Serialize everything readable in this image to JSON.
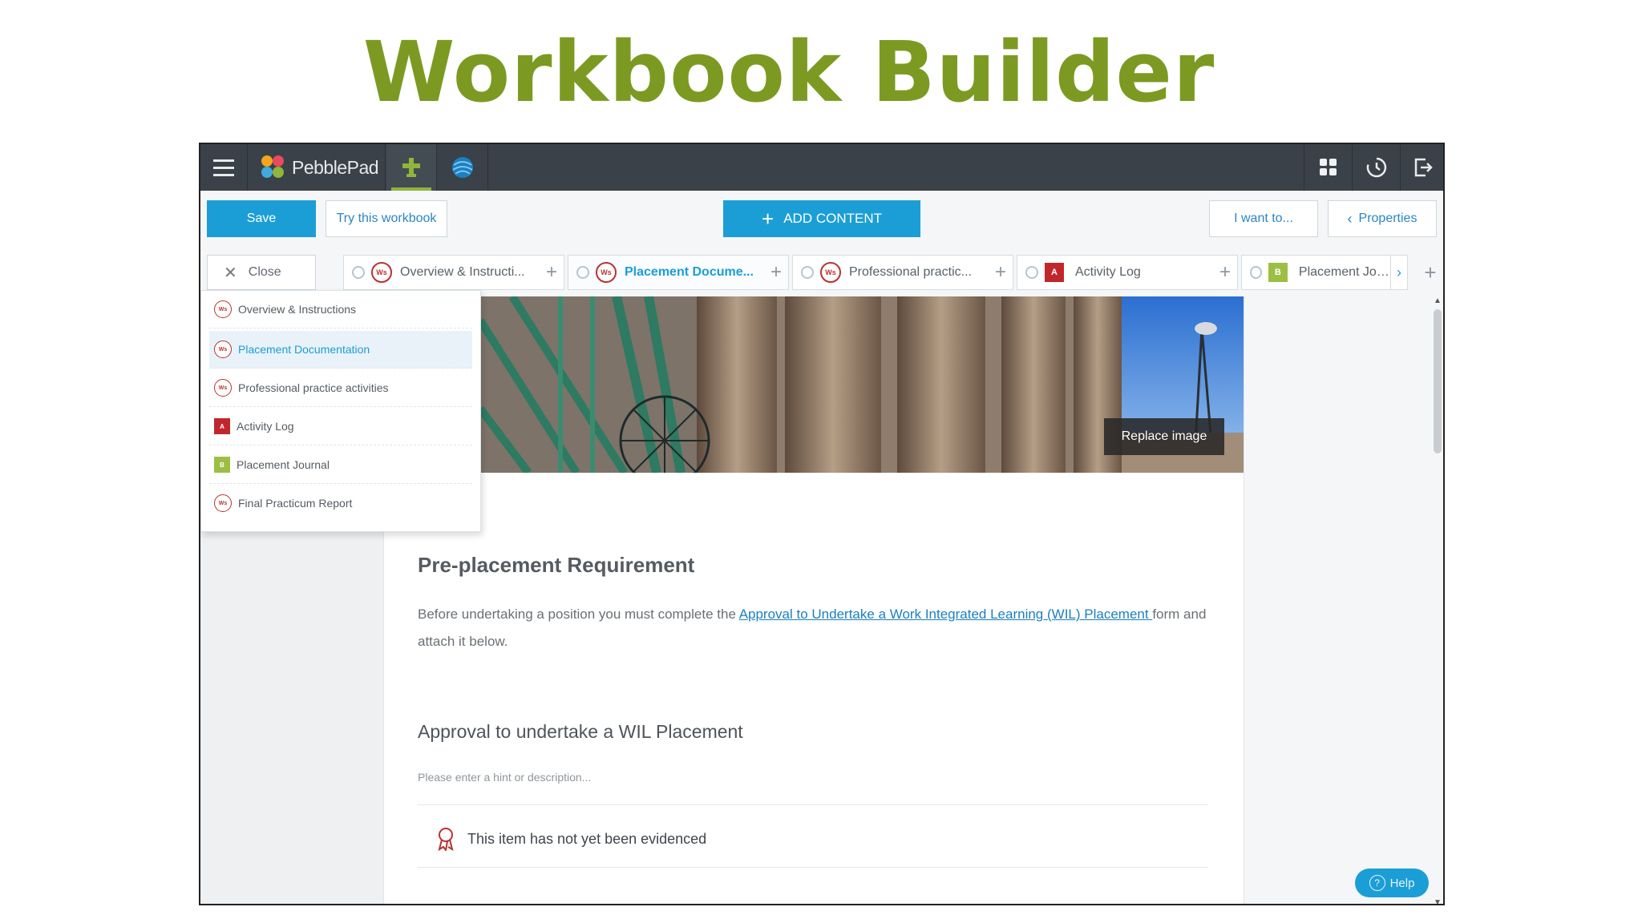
{
  "slide": {
    "title": "Workbook Builder"
  },
  "app": {
    "name": "PebblePad"
  },
  "toolbar": {
    "save_label": "Save",
    "try_label": "Try this workbook",
    "add_content_label": "ADD CONTENT",
    "i_want_label": "I want to...",
    "properties_label": "Properties"
  },
  "tabs": {
    "close_label": "Close",
    "items": [
      {
        "label": "Overview & Instructi...",
        "badge": "Ws"
      },
      {
        "label": "Placement Docume...",
        "badge": "Ws"
      },
      {
        "label": "Professional practic...",
        "badge": "Ws"
      },
      {
        "label": "Activity Log",
        "badge": "A"
      },
      {
        "label": "Placement Journ...",
        "badge": "B"
      }
    ]
  },
  "dropdown": {
    "items": [
      {
        "label": "Overview & Instructions",
        "badge": "Ws"
      },
      {
        "label": "Placement Documentation",
        "badge": "Ws"
      },
      {
        "label": "Professional practice activities",
        "badge": "Ws"
      },
      {
        "label": "Activity Log",
        "badge": "A"
      },
      {
        "label": "Placement Journal",
        "badge": "B"
      },
      {
        "label": "Final Practicum Report",
        "badge": "Ws"
      }
    ]
  },
  "page": {
    "replace_image_label": "Replace image",
    "heading": "Pre-placement Requirement",
    "para_before": "Before undertaking a position you must complete the ",
    "para_link": "Approval to Undertake a Work Integrated Learning (WIL) Placement ",
    "para_after": "form and attach it below.",
    "approval_heading": "Approval to undertake a WIL Placement",
    "hint": "Please enter a hint or description...",
    "evidence_status": "This item has not yet been evidenced"
  },
  "help": {
    "label": "Help"
  },
  "colors": {
    "accent": "#1b9ed6",
    "title_green": "#7c9a22",
    "topbar": "#3a4148",
    "ws_red": "#b83232",
    "activity_red": "#c0272d",
    "journal_green": "#9cbe45"
  },
  "icons": [
    "hamburger-icon",
    "pebblepad-logo",
    "builder-icon",
    "globe-icon",
    "apps-grid-icon",
    "history-icon",
    "logout-icon",
    "close-icon",
    "gear-icon",
    "plus-icon",
    "chevron-left-icon",
    "chevron-right-icon",
    "award-ribbon-icon",
    "help-icon"
  ]
}
